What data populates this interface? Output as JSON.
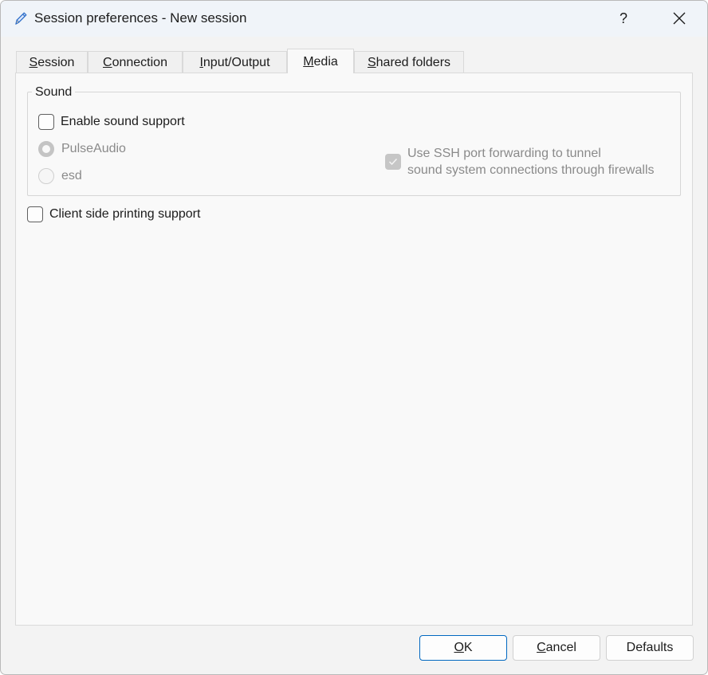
{
  "window": {
    "title": "Session preferences - New session",
    "help_label": "?",
    "icon": "pencil-icon"
  },
  "tabs": [
    {
      "mnemonic": "S",
      "rest": "ession",
      "active": false
    },
    {
      "mnemonic": "C",
      "rest": "onnection",
      "active": false
    },
    {
      "mnemonic": "I",
      "rest": "nput/Output",
      "active": false
    },
    {
      "mnemonic": "M",
      "rest": "edia",
      "active": true
    },
    {
      "mnemonic": "S",
      "rest": "hared folders",
      "active": false
    }
  ],
  "sound": {
    "group_label": "Sound",
    "enable_label": "Enable sound support",
    "enable_checked": false,
    "pulse_label": "PulseAudio",
    "pulse_selected": true,
    "esd_label": "esd",
    "esd_selected": false,
    "ssh_line1": "Use SSH port forwarding to tunnel",
    "ssh_line2": "sound system connections through firewalls",
    "ssh_checked": true
  },
  "printing": {
    "label": "Client side printing support",
    "checked": false
  },
  "buttons": {
    "ok": {
      "mnemonic": "O",
      "rest": "K"
    },
    "cancel": {
      "mnemonic": "C",
      "rest": "ancel"
    },
    "defaults": "Defaults"
  },
  "colors": {
    "accent": "#0067c0",
    "titlebar": "#f0f4f9",
    "panel": "#f9f9f9",
    "disabled_text": "#8a8a8a"
  }
}
